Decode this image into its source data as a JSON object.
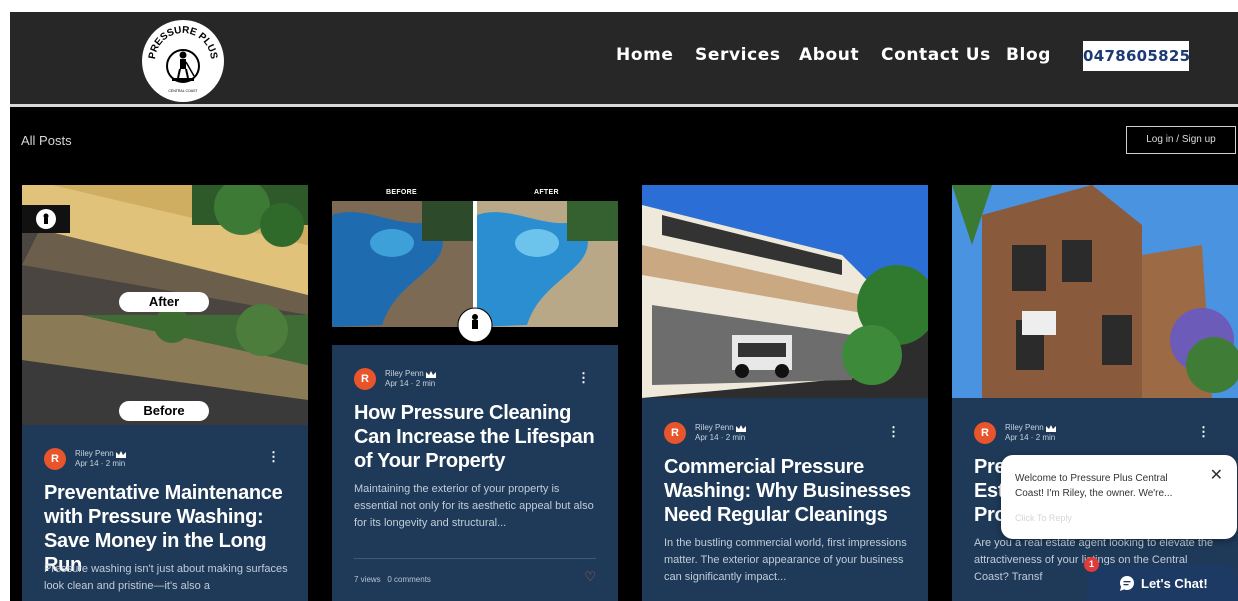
{
  "header": {
    "logo_alt": "Pressure Plus Central Coast",
    "logo_text_top": "PRESSURE PLUS",
    "logo_text_bottom": "CENTRAL COAST",
    "nav": [
      "Home",
      "Services",
      "About",
      "Contact Us",
      "Blog"
    ],
    "phone": "0478605825"
  },
  "blog": {
    "section_label": "All Posts",
    "login_label": "Log in / Sign up"
  },
  "posts": [
    {
      "image_labels": [
        "After",
        "Before"
      ],
      "author": "Riley Penn",
      "avatar_initial": "R",
      "date": "Apr 14",
      "read_time": "2 min",
      "title": "Preventative Maintenance with Pressure Washing: Save Money in the Long Run",
      "excerpt": "Pressure washing isn't just about making surfaces look clean and pristine—it's also a"
    },
    {
      "image_labels": [
        "BEFORE",
        "AFTER"
      ],
      "author": "Riley Penn",
      "avatar_initial": "R",
      "date": "Apr 14",
      "read_time": "2 min",
      "title": "How Pressure Cleaning Can Increase the Lifespan of Your Property",
      "excerpt": "Maintaining the exterior of your property is essential not only for its aesthetic appeal but also for its longevity and structural...",
      "views": "7 views",
      "comments": "0 comments"
    },
    {
      "author": "Riley Penn",
      "avatar_initial": "R",
      "date": "Apr 14",
      "read_time": "2 min",
      "title": "Commercial Pressure Washing: Why Businesses Need Regular Cleanings",
      "excerpt": "In the bustling commercial world, first impressions matter. The exterior appearance of your business can significantly impact..."
    },
    {
      "author": "Riley Penn",
      "avatar_initial": "R",
      "date": "Apr 14",
      "read_time": "2 min",
      "title_visible": "Pre Esta Pro",
      "excerpt_visible": "Are you a real estate agent looking to elevate the attractiveness of your listings on the Central Coast? Transf"
    }
  ],
  "chat": {
    "message": "Welcome to Pressure Plus Central Coast! I'm Riley, the owner. We're...",
    "reply_hint": "Click To Reply",
    "button_label": "Let's Chat!",
    "badge_count": "1"
  },
  "colors": {
    "header_bg": "#272727",
    "card_bg": "#1e3a58",
    "avatar": "#e8542b",
    "phone_text": "#1c3a73",
    "chat_button": "#1c3a63"
  }
}
